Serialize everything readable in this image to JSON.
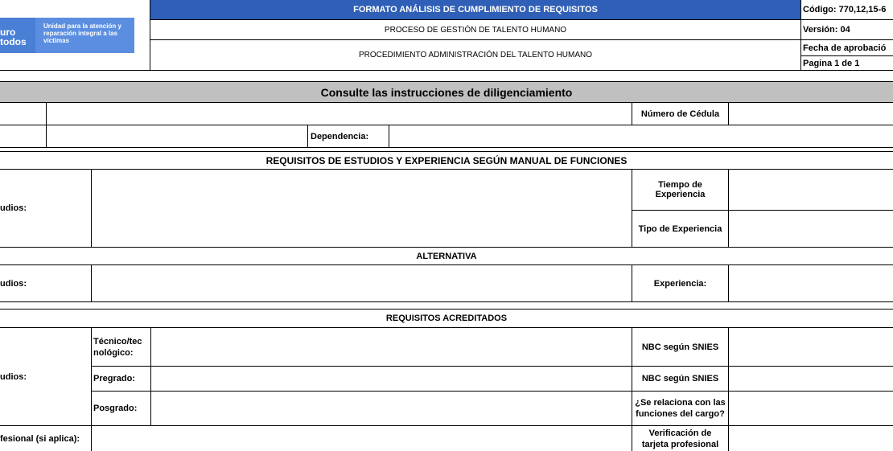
{
  "logo": {
    "left_text_line1": "uro",
    "left_text_line2": "todos",
    "right_text": "Unidad para la atención y reparación integral a las víctimas",
    "brand_color": "#4a7fd6"
  },
  "header": {
    "title": "FORMATO ANÁLISIS DE CUMPLIMIENTO DE REQUISITOS",
    "process": "PROCESO DE GESTIÓN DE TALENTO HUMANO",
    "procedure": "PROCEDIMIENTO ADMINISTRACIÓN DEL TALENTO HUMANO",
    "codigo": "Código: 770,12,15-6",
    "version": "Versión: 04",
    "fecha": "Fecha de aprobació",
    "pagina": "Pagina 1 de 1",
    "title_bg": "#2f5fb6"
  },
  "instructions": "Consulte las instrucciones de diligenciamiento",
  "fields": {
    "numero_cedula": "Número de Cédula",
    "dependencia": "Dependencia:"
  },
  "section_requisitos": {
    "title": "REQUISITOS DE ESTUDIOS Y EXPERIENCIA SEGÚN MANUAL DE FUNCIONES",
    "estudios": "udios:",
    "tiempo_experiencia": "Tiempo de Experiencia",
    "tipo_experiencia": "Tipo de Experiencia"
  },
  "section_alternativa": {
    "title": "ALTERNATIVA",
    "estudios": "udios:",
    "experiencia": "Experiencia:"
  },
  "section_acreditados": {
    "title": "REQUISITOS ACREDITADOS",
    "estudios": "udios:",
    "tecnico": "Técnico/tecnológico:",
    "pregrado": "Pregrado:",
    "posgrado": "Posgrado:",
    "nbc1": "NBC según SNIES",
    "nbc2": "NBC según SNIES",
    "relaciona": "¿Se relaciona con las funciones del cargo?",
    "tarjeta_label": "fesional (si aplica):",
    "verificacion": "Verificación de tarjeta profesional"
  }
}
